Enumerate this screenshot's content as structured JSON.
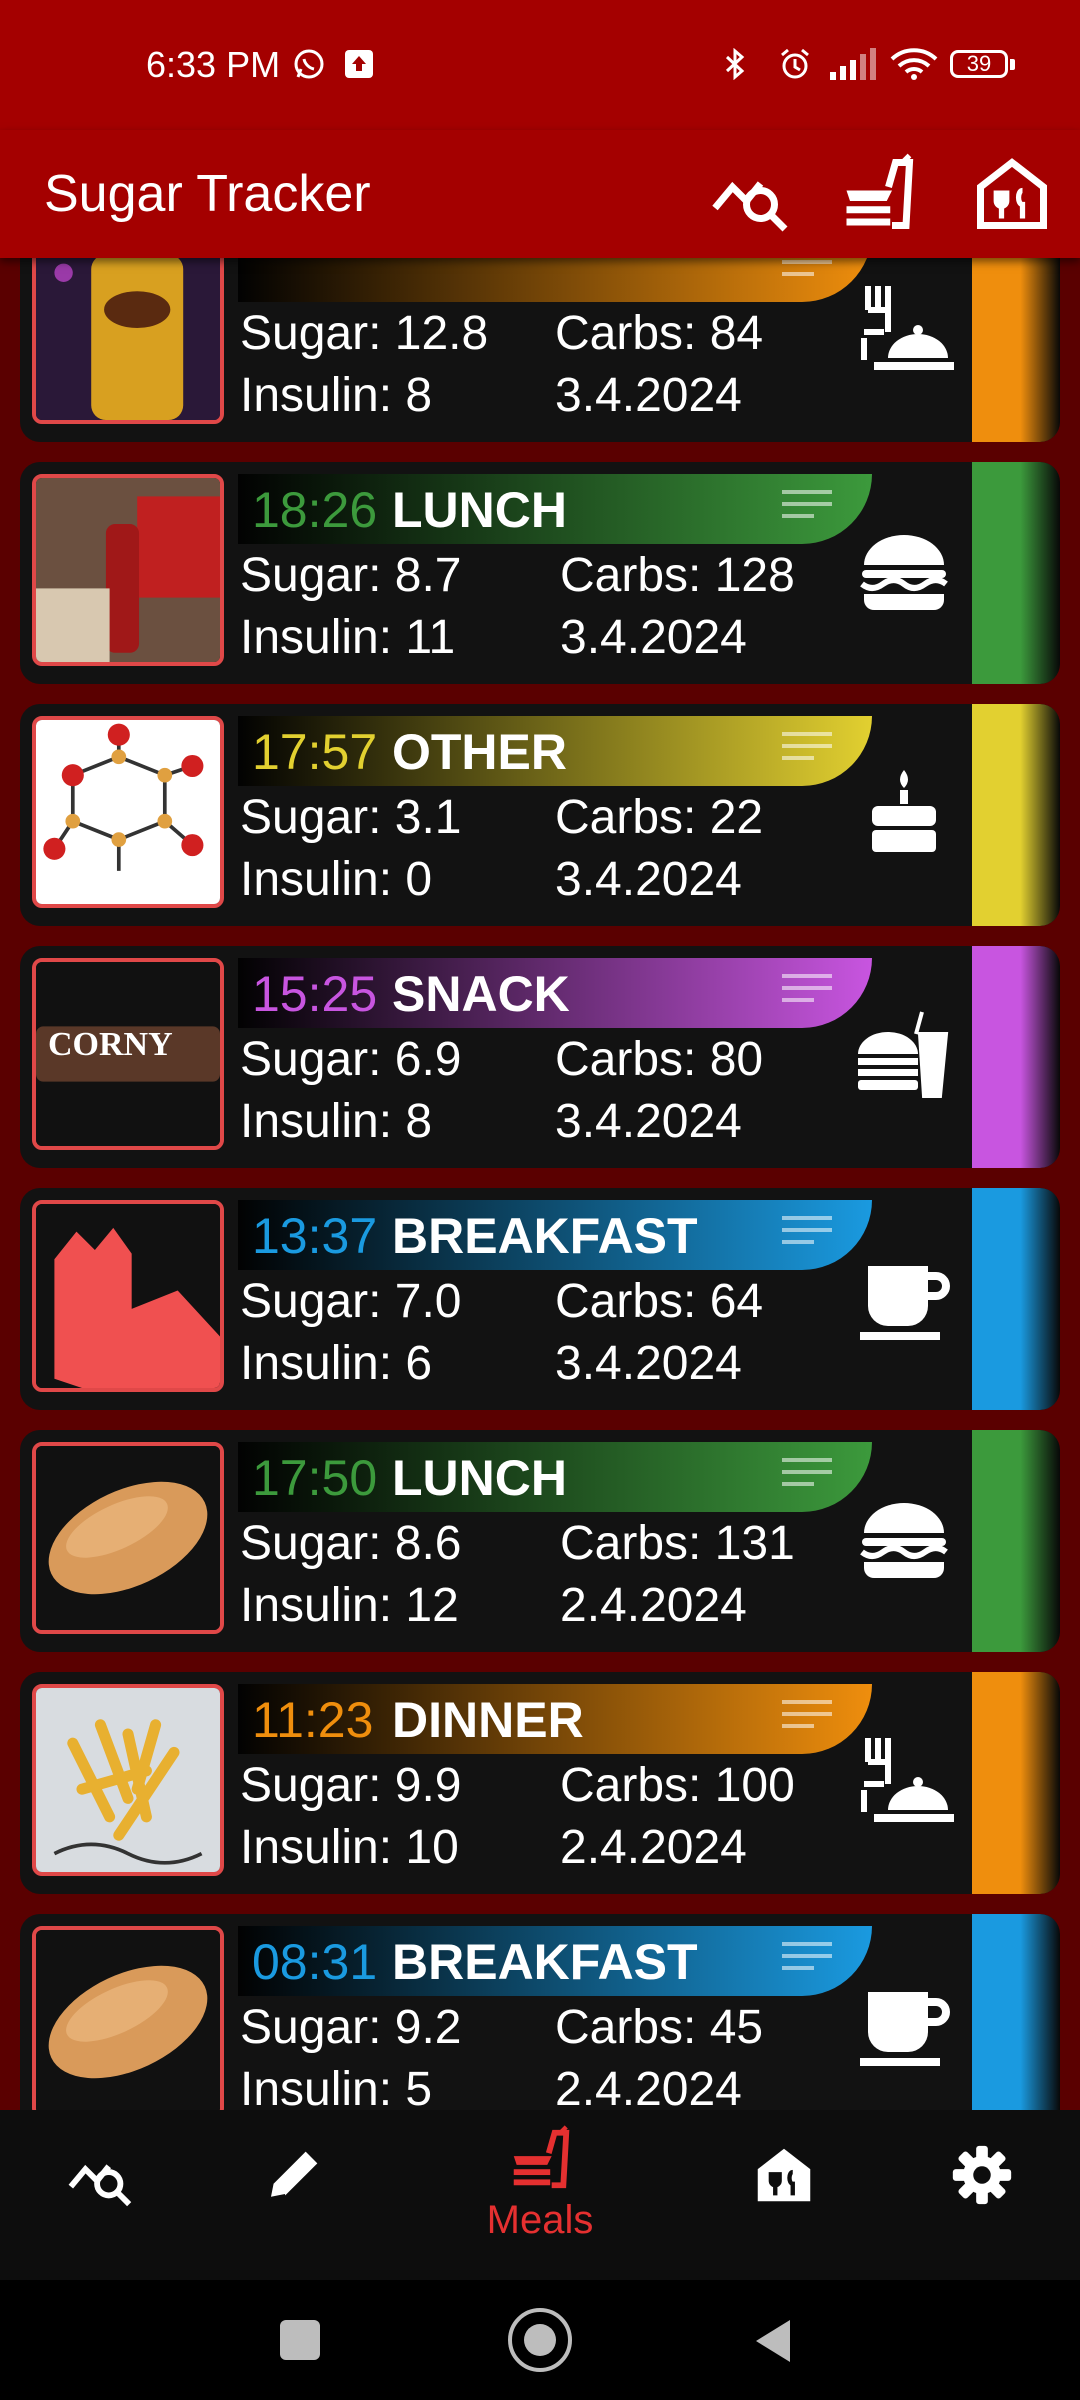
{
  "status_bar": {
    "time": "6:33 PM",
    "battery": "39",
    "icons": [
      "whatsapp-icon",
      "upload-icon",
      "bluetooth-icon",
      "alarm-icon",
      "signal-icon",
      "wifi-icon",
      "battery-icon"
    ]
  },
  "app_bar": {
    "title": "Sugar Tracker",
    "actions": [
      "stats-search-icon",
      "meal-food-icon",
      "restaurant-icon"
    ]
  },
  "colors": {
    "bar": "#a40000",
    "list_bg": "#5a0000",
    "card_bg": "#121212",
    "lunch": "#3c9a3c",
    "other": "#e2d030",
    "snack": "#c855e0",
    "breakfast": "#1a9ae0",
    "dinner": "#ef8e0d",
    "nav_active": "#e53030"
  },
  "meals": [
    {
      "time": "",
      "category": "",
      "sugar": "Sugar: 12.8",
      "carbs": "Carbs: 84",
      "insulin": "Insulin: 8",
      "date": "3.4.2024",
      "kind": "dinner",
      "icon": "dinner-plate-icon",
      "thumb": "soda-can-image"
    },
    {
      "time": "18:26",
      "category": "LUNCH",
      "sugar": "Sugar: 8.7",
      "carbs": "Carbs: 128",
      "insulin": "Insulin: 11",
      "date": "3.4.2024",
      "kind": "lunch",
      "icon": "burger-icon",
      "thumb": "person-bottle-image"
    },
    {
      "time": "17:57",
      "category": "OTHER",
      "sugar": "Sugar: 3.1",
      "carbs": "Carbs: 22",
      "insulin": "Insulin: 0",
      "date": "3.4.2024",
      "kind": "other",
      "icon": "cake-icon",
      "thumb": "molecule-image"
    },
    {
      "time": "15:25",
      "category": "SNACK",
      "sugar": "Sugar: 6.9",
      "carbs": "Carbs: 80",
      "insulin": "Insulin: 8",
      "date": "3.4.2024",
      "kind": "snack",
      "icon": "snack-drink-icon",
      "thumb": "candy-bar-image",
      "thumb_text": "CORNY"
    },
    {
      "time": "13:37",
      "category": "BREAKFAST",
      "sugar": "Sugar: 7.0",
      "carbs": "Carbs: 64",
      "insulin": "Insulin: 6",
      "date": "3.4.2024",
      "kind": "breakfast",
      "icon": "coffee-cup-icon",
      "thumb": "fruit-placeholder-image"
    },
    {
      "time": "17:50",
      "category": "LUNCH",
      "sugar": "Sugar: 8.6",
      "carbs": "Carbs: 131",
      "insulin": "Insulin: 12",
      "date": "2.4.2024",
      "kind": "lunch",
      "icon": "burger-icon",
      "thumb": "bread-roll-image"
    },
    {
      "time": "11:23",
      "category": "DINNER",
      "sugar": "Sugar: 9.9",
      "carbs": "Carbs: 100",
      "insulin": "Insulin: 10",
      "date": "2.4.2024",
      "kind": "dinner",
      "icon": "dinner-plate-icon",
      "thumb": "fries-image"
    },
    {
      "time": "08:31",
      "category": "BREAKFAST",
      "sugar": "Sugar: 9.2",
      "carbs": "Carbs: 45",
      "insulin": "Insulin: 5",
      "date": "2.4.2024",
      "kind": "breakfast",
      "icon": "coffee-cup-icon",
      "thumb": "bread-roll-image"
    }
  ],
  "bottom_nav": {
    "items": [
      {
        "icon": "stats-search-icon",
        "label": ""
      },
      {
        "icon": "pencil-icon",
        "label": ""
      },
      {
        "icon": "meal-food-icon",
        "label": "Meals",
        "active": true
      },
      {
        "icon": "restaurant-icon",
        "label": ""
      },
      {
        "icon": "gear-icon",
        "label": ""
      }
    ]
  },
  "system_nav": [
    "recents-button",
    "home-button",
    "back-button"
  ]
}
